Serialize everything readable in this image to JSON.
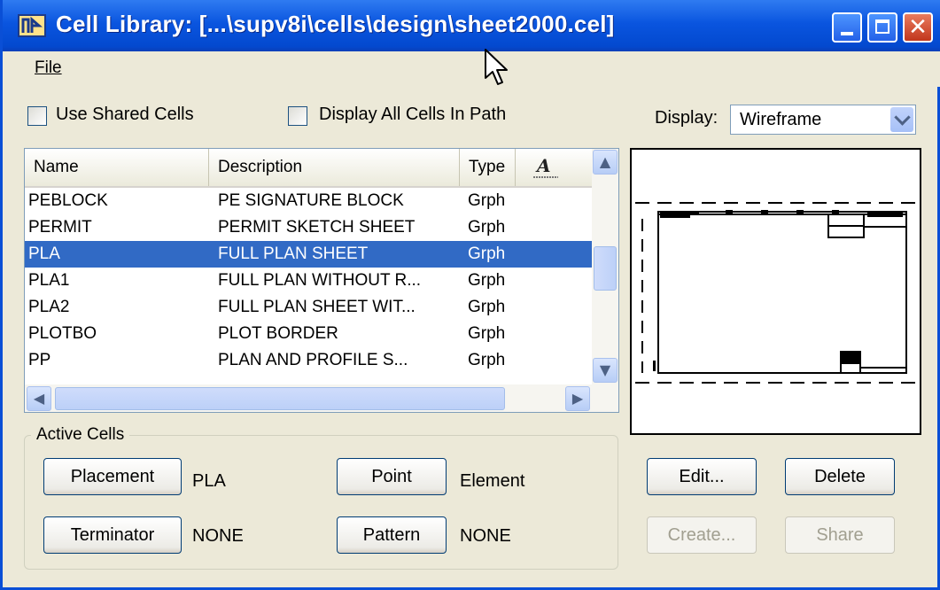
{
  "window": {
    "title": "Cell Library: [...\\supv8i\\cells\\design\\sheet2000.cel]",
    "close_glyph": "✕"
  },
  "menu": {
    "file": "File"
  },
  "options": {
    "use_shared_cells": "Use Shared Cells",
    "display_all_cells": "Display All Cells In Path",
    "display_label": "Display:",
    "display_value": "Wireframe"
  },
  "list": {
    "columns": [
      "Name",
      "Description",
      "Type"
    ],
    "rows": [
      {
        "name": "PEBLOCK",
        "description": "PE SIGNATURE BLOCK",
        "type": "Grph"
      },
      {
        "name": "PERMIT",
        "description": "PERMIT SKETCH SHEET",
        "type": "Grph"
      },
      {
        "name": "PLA",
        "description": "FULL PLAN SHEET",
        "type": "Grph"
      },
      {
        "name": "PLA1",
        "description": "FULL PLAN WITHOUT R...",
        "type": "Grph"
      },
      {
        "name": "PLA2",
        "description": "FULL PLAN SHEET WIT...",
        "type": "Grph"
      },
      {
        "name": "PLOTBO",
        "description": "PLOT BORDER",
        "type": "Grph"
      },
      {
        "name": "PP",
        "description": "PLAN AND PROFILE S...",
        "type": "Grph"
      }
    ],
    "selected_index": 2
  },
  "active_cells": {
    "legend": "Active Cells",
    "placement_label": "Placement",
    "placement_value": "PLA",
    "terminator_label": "Terminator",
    "terminator_value": "NONE",
    "point_label": "Point",
    "point_value": "Element",
    "pattern_label": "Pattern",
    "pattern_value": "NONE"
  },
  "actions": {
    "edit": "Edit...",
    "delete": "Delete",
    "create": "Create...",
    "share": "Share"
  }
}
